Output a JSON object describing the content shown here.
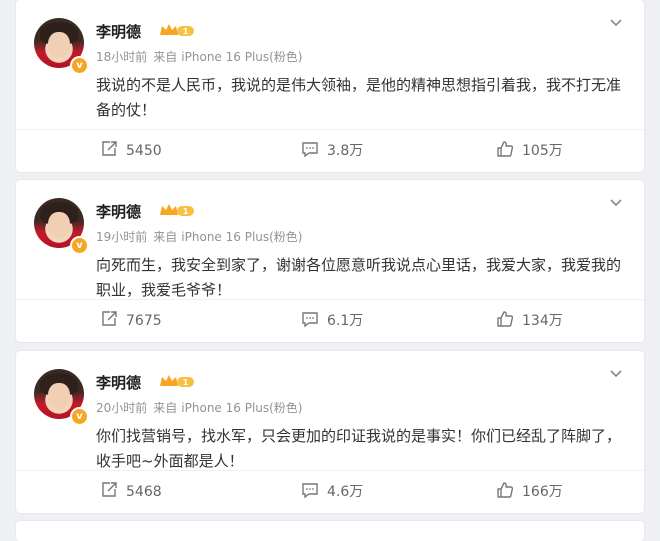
{
  "posts": [
    {
      "name": "李明德",
      "vip_level": "1",
      "verified_mark": "v",
      "time": "18小时前",
      "source_prefix": "来自",
      "source": "iPhone 16 Plus(粉色)",
      "text": "我说的不是人民币，我说的是伟大领袖，是他的精神思想指引着我，我不打无准备的仗！",
      "reposts": "5450",
      "comments": "3.8万",
      "likes": "105万"
    },
    {
      "name": "李明德",
      "vip_level": "1",
      "verified_mark": "v",
      "time": "19小时前",
      "source_prefix": "来自",
      "source": "iPhone 16 Plus(粉色)",
      "text": "向死而生，我安全到家了，谢谢各位愿意听我说点心里话，我爱大家，我爱我的职业，我爱毛爷爷！",
      "reposts": "7675",
      "comments": "6.1万",
      "likes": "134万"
    },
    {
      "name": "李明德",
      "vip_level": "1",
      "verified_mark": "v",
      "time": "20小时前",
      "source_prefix": "来自",
      "source": "iPhone 16 Plus(粉色)",
      "text": "你们找营销号，找水军，只会更加的印证我说的是事实！你们已经乱了阵脚了，收手吧~外面都是人！",
      "reposts": "5468",
      "comments": "4.6万",
      "likes": "166万"
    }
  ],
  "icons": {
    "repost": "repost-icon",
    "comment": "comment-icon",
    "like": "like-icon",
    "more": "chevron-down-icon",
    "vip": "crown-icon"
  },
  "colors": {
    "background": "#eef0f3",
    "card": "#ffffff",
    "meta": "#939393",
    "vip_gold": "#f6a623"
  }
}
